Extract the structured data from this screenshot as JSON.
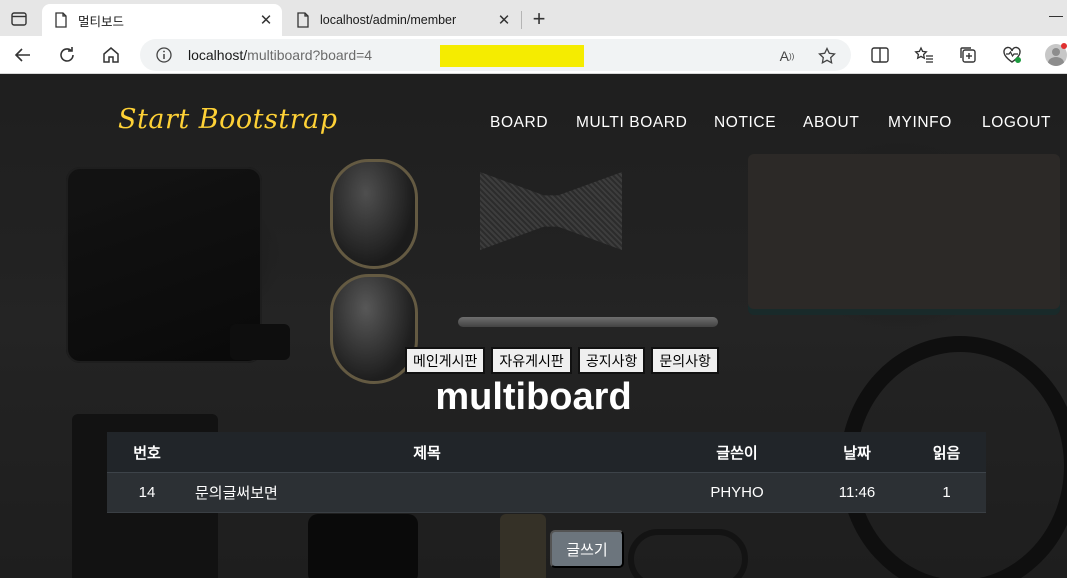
{
  "browser": {
    "tabs": [
      {
        "title": "멀티보드",
        "active": true
      },
      {
        "title": "localhost/admin/member",
        "active": false
      }
    ],
    "url": {
      "host": "localhost/",
      "path": "multiboard?board=4"
    },
    "highlight_color": "#f5ec00"
  },
  "site": {
    "brand": "Start Bootstrap",
    "brand_color": "#fed136",
    "nav": [
      "BOARD",
      "MULTI BOARD",
      "NOTICE",
      "ABOUT",
      "MYINFO",
      "LOGOUT"
    ],
    "board_buttons": [
      "메인게시판",
      "자유게시판",
      "공지사항",
      "문의사항"
    ],
    "title": "multiboard",
    "table": {
      "headers": {
        "no": "번호",
        "title": "제목",
        "writer": "글쓴이",
        "date": "날짜",
        "read": "읽음"
      },
      "rows": [
        {
          "no": "14",
          "title": "문의글써보면",
          "writer": "PHYHO",
          "date": "11:46",
          "read": "1"
        }
      ]
    },
    "write_button": "글쓰기"
  }
}
